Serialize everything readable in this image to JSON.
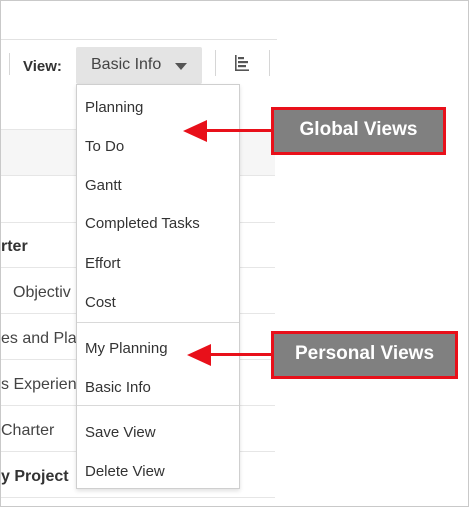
{
  "toolbar": {
    "view_label": "View:",
    "view_value": "Basic Info"
  },
  "background_rows": [
    "rter",
    "Objectiv",
    "es and Pla",
    "s Experien",
    "Charter",
    "y Project"
  ],
  "menu": {
    "global_items": [
      "Planning",
      "To Do",
      "Gantt",
      "Completed Tasks",
      "Effort",
      "Cost"
    ],
    "personal_items": [
      "My Planning",
      "Basic Info"
    ],
    "action_items": [
      "Save View",
      "Delete View"
    ]
  },
  "callouts": {
    "global": "Global Views",
    "personal": "Personal Views"
  },
  "colors": {
    "callout_bg": "#808080",
    "callout_border": "#e8101a",
    "arrow": "#e8101a",
    "select_bg": "#e4e4e4"
  },
  "icons": [
    "chevron-down-icon",
    "bar-chart-icon"
  ]
}
